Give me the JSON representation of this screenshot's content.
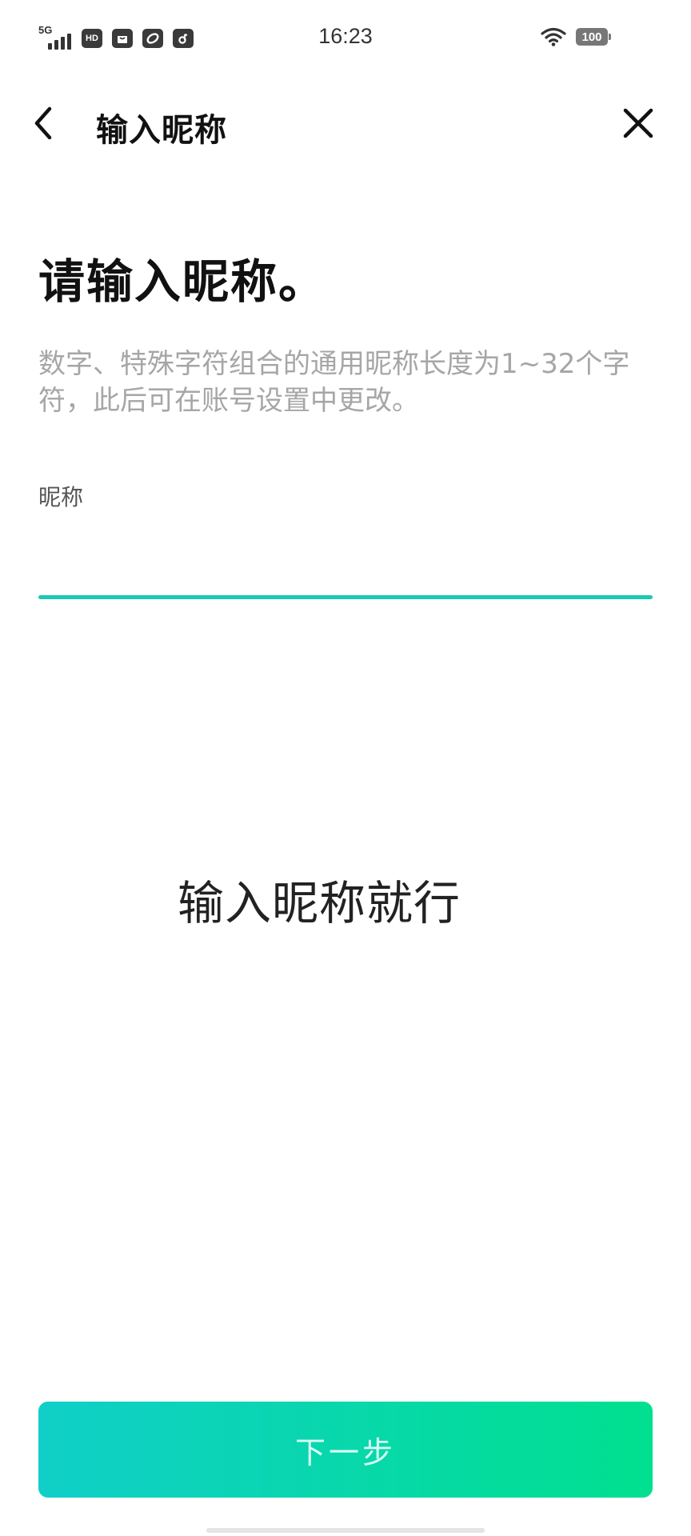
{
  "status_bar": {
    "network": "5G",
    "hd_badge": "HD",
    "time": "16:23",
    "battery": "100",
    "icons": [
      "signal-icon",
      "hd-icon",
      "bag-app-icon",
      "link-app-icon",
      "music-app-icon",
      "wifi-icon",
      "battery-icon"
    ]
  },
  "header": {
    "title": "输入昵称",
    "back_icon": "chevron-left-icon",
    "close_icon": "close-icon"
  },
  "content": {
    "title": "请输入昵称。",
    "description": "数字、特殊字符组合的通用昵称长度为1~32个字符，此后可在账号设置中更改。",
    "field_label": "昵称",
    "input_value": "",
    "overlay_caption": "输入昵称就行"
  },
  "footer": {
    "next_label": "下一步"
  },
  "colors": {
    "accent": "#1cc8b4",
    "button_gradient_start": "#10cfc8",
    "button_gradient_end": "#00e08f",
    "description_text": "#a6a6a6"
  }
}
